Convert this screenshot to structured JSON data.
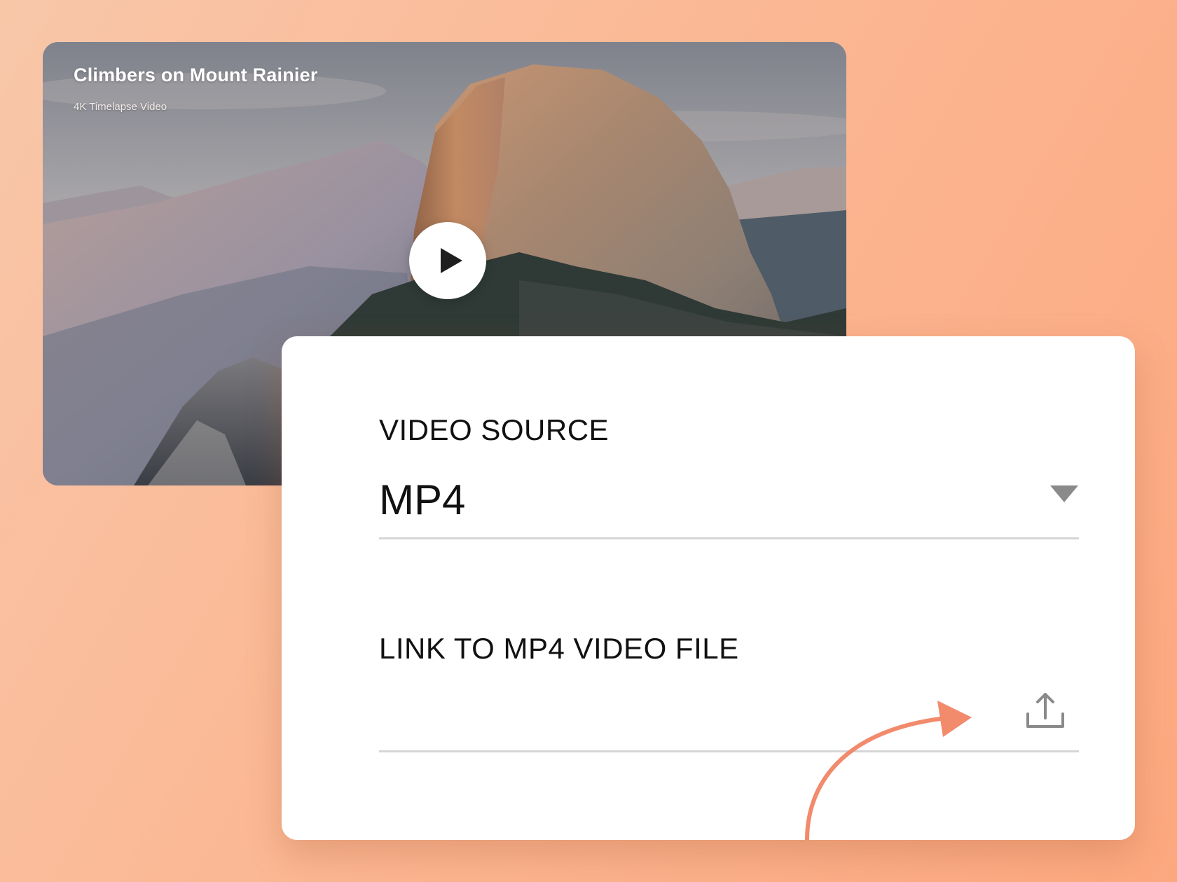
{
  "video": {
    "title": "Climbers on Mount Rainier",
    "subtitle": "4K Timelapse Video",
    "play_icon": "play-icon"
  },
  "form": {
    "source_label": "VIDEO SOURCE",
    "source_value": "MP4",
    "source_dropdown_icon": "triangle-down-icon",
    "link_label": "LINK TO MP4 VIDEO FILE",
    "link_value": "",
    "upload_icon": "upload-icon"
  },
  "colors": {
    "accent_arrow": "#f28a6c",
    "divider": "#d6d6d6",
    "icon_gray": "#8a8a8a"
  }
}
